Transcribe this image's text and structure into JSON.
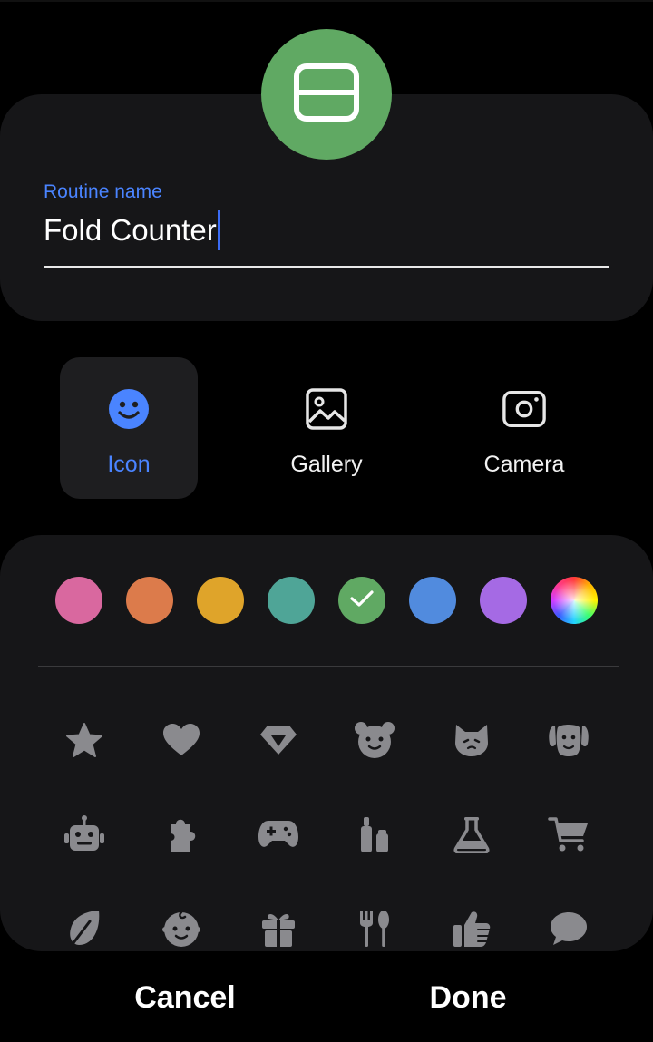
{
  "routine": {
    "badge_icon": "fold-phone-icon",
    "badge_color": "#60a963"
  },
  "name_field": {
    "label": "Routine name",
    "value": "Fold Counter"
  },
  "source_tabs": [
    {
      "label": "Icon",
      "icon": "smiley-icon",
      "selected": true
    },
    {
      "label": "Gallery",
      "icon": "image-icon",
      "selected": false
    },
    {
      "label": "Camera",
      "icon": "camera-icon",
      "selected": false
    }
  ],
  "colors": [
    {
      "name": "pink",
      "hex": "#d9689f"
    },
    {
      "name": "orange",
      "hex": "#dc7b4b"
    },
    {
      "name": "amber",
      "hex": "#dfa42a"
    },
    {
      "name": "teal",
      "hex": "#4fa597"
    },
    {
      "name": "green",
      "hex": "#60a963",
      "selected": true
    },
    {
      "name": "blue",
      "hex": "#518bde"
    },
    {
      "name": "purple",
      "hex": "#a56ae4"
    },
    {
      "name": "custom",
      "hex": "rainbow"
    }
  ],
  "icon_grid": [
    [
      "star-icon",
      "heart-icon",
      "diamond-icon",
      "bear-icon",
      "cat-icon",
      "dog-icon"
    ],
    [
      "robot-icon",
      "puzzle-icon",
      "gamepad-icon",
      "cosmetics-icon",
      "flask-icon",
      "cart-icon"
    ],
    [
      "leaf-icon",
      "baby-icon",
      "gift-icon",
      "utensils-icon",
      "thumbs-up-icon",
      "chat-icon"
    ]
  ],
  "actions": {
    "cancel": "Cancel",
    "done": "Done"
  }
}
